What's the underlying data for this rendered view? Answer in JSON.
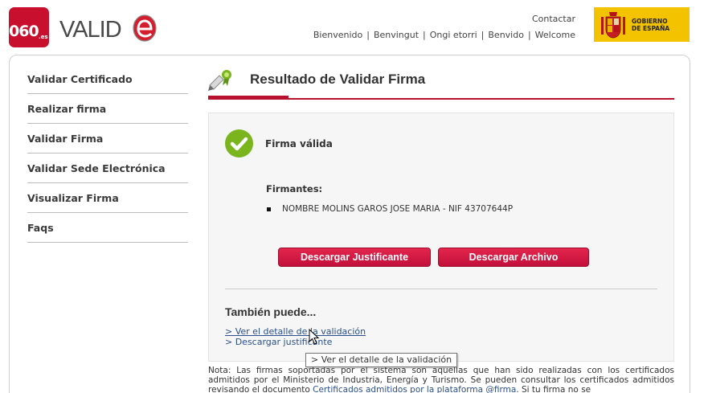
{
  "header": {
    "logo_060": "060",
    "logo_es": ".es",
    "logo_valide": "VALID",
    "contact": "Contactar",
    "languages": [
      "Bienvenido",
      "Benvingut",
      "Ongi etorri",
      "Benvido",
      "Welcome"
    ],
    "gob_line1": "GOBIERNO",
    "gob_line2": "DE ESPAÑA"
  },
  "sidebar": {
    "items": [
      {
        "label": "Validar Certificado"
      },
      {
        "label": "Realizar firma"
      },
      {
        "label": "Validar Firma"
      },
      {
        "label": "Validar Sede Electrónica"
      },
      {
        "label": "Visualizar Firma"
      },
      {
        "label": "Faqs"
      }
    ]
  },
  "main": {
    "title": "Resultado de Validar Firma",
    "status": "Firma válida",
    "signers_label": "Firmantes:",
    "signer": "NOMBRE MOLINS GAROS JOSE MARIA - NIF 43707644P",
    "btn_justificante": "Descargar Justificante",
    "btn_archivo": "Descargar Archivo",
    "also_title": "También puede...",
    "link_detail": "> Ver el detalle de la validación",
    "link_download": "> Descargar justificante",
    "tooltip": "> Ver el detalle de la validación",
    "note_prefix": "Nota: Las firmas soportadas por el sistema son aquellas que han sido realizadas con los certificados admitidos por el Ministerio de Industria, Energía y Turismo. Se pueden consultar los certificados admitidos revisando el documento ",
    "note_link": "Certificados admitidos por la plataforma @firma",
    "note_suffix": ". Si tu firma no se"
  },
  "colors": {
    "brand_red": "#c8102e",
    "accent_red": "#b8112e",
    "valid_green": "#7ab51d",
    "gob_yellow": "#f3c300",
    "link_blue": "#2a4f8a"
  }
}
